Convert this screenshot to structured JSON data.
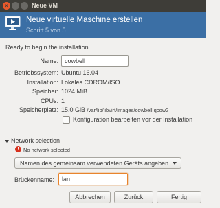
{
  "window": {
    "title": "Neue VM"
  },
  "banner": {
    "title": "Neue virtuelle Maschine erstellen",
    "step": "Schritt 5 von 5"
  },
  "summary": {
    "heading": "Ready to begin the installation",
    "name_label": "Name:",
    "name_value": "cowbell",
    "rows": [
      {
        "label": "Betriebssystem:",
        "value": "Ubuntu 16.04"
      },
      {
        "label": "Installation:",
        "value": "Lokales CDROM/ISO"
      },
      {
        "label": "Speicher:",
        "value": "1024 MiB"
      },
      {
        "label": "CPUs:",
        "value": "1"
      },
      {
        "label": "Speicherplatz:",
        "value": "15.0 GiB",
        "detail": "/var/lib/libvirt/images/cowbell.qcow2"
      }
    ],
    "customize_checkbox": {
      "label": "Konfiguration bearbeiten vor der Installation",
      "checked": false
    }
  },
  "network": {
    "expander_label": "Network selection",
    "error_text": "No network selected",
    "source_selected": "Namen des gemeinsam verwendeten Geräts angeben",
    "bridge_label": "Brückenname:",
    "bridge_value": "lan"
  },
  "buttons": {
    "cancel": "Abbrechen",
    "back": "Zurück",
    "finish": "Fertig"
  },
  "colors": {
    "banner": "#3b6fa5",
    "titlebar": "#3e3d38",
    "close": "#e9592b",
    "error": "#d7311e",
    "focus": "#e8842d"
  }
}
